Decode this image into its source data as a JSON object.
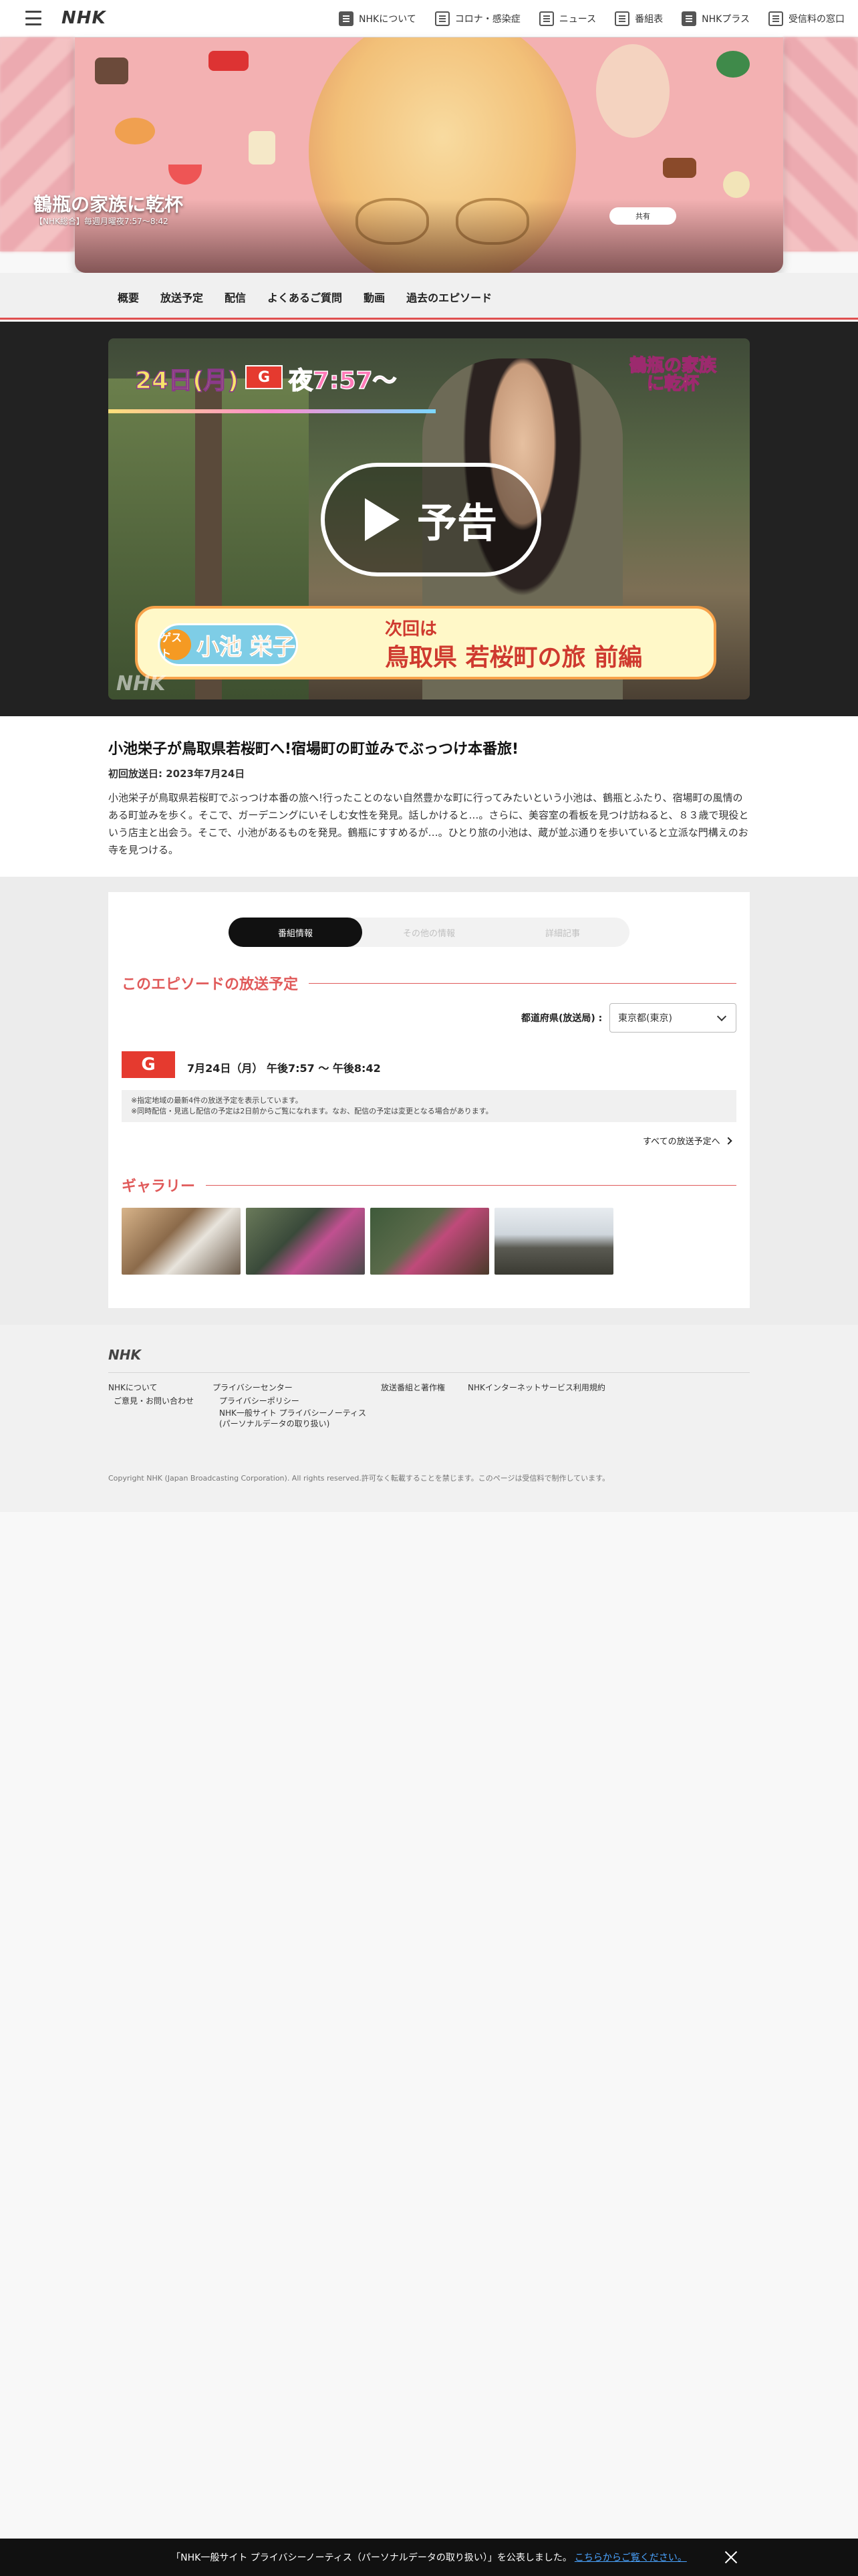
{
  "header": {
    "logo": "NHK",
    "nav": [
      {
        "label": "NHKについて",
        "icon": "nhk-icon"
      },
      {
        "label": "コロナ・感染症",
        "icon": "virus-icon"
      },
      {
        "label": "ニュース",
        "icon": "news-icon"
      },
      {
        "label": "番組表",
        "icon": "schedule-icon"
      },
      {
        "label": "NHKプラス",
        "icon": "plus-icon"
      },
      {
        "label": "受信料の窓口",
        "icon": "fee-icon"
      }
    ]
  },
  "hero": {
    "title": "鶴瓶の家族に乾杯",
    "subtitle": "【NHK総合】毎週月曜夜7:57〜8:42",
    "share_label": "共有"
  },
  "subnav": [
    "概要",
    "放送予定",
    "配信",
    "よくあるご質問",
    "動画",
    "過去のエピソード"
  ],
  "video": {
    "date": "24日(月)",
    "channel": "G",
    "time": "夜7:57〜",
    "show_logo": "鶴瓶の家族に乾杯",
    "play_label": "予告",
    "guest_tag": "ゲスト",
    "guest_name": "小池 栄子",
    "next_label": "次回は",
    "place": "鳥取県 若桜町の旅 前編",
    "watermark": "NHK"
  },
  "episode": {
    "title": "小池栄子が鳥取県若桜町へ!宿場町の町並みでぶっつけ本番旅!",
    "first_air": "初回放送日: 2023年7月24日",
    "description": "小池栄子が鳥取県若桜町でぶっつけ本番の旅へ!行ったことのない自然豊かな町に行ってみたいという小池は、鶴瓶とふたり、宿場町の風情のある町並みを歩く。そこで、ガーデニングにいそしむ女性を発見。話しかけると…。さらに、美容室の看板を見つけ訪ねると、８３歳で現役という店主と出会う。そこで、小池があるものを発見。鶴瓶にすすめるが…。ひとり旅の小池は、蔵が並ぶ通りを歩いていると立派な門構えのお寺を見つける。"
  },
  "panel": {
    "tabs": [
      "番組情報",
      "その他の情報",
      "詳細記事"
    ],
    "schedule_heading": "このエピソードの放送予定",
    "region_label": "都道府県(放送局) :",
    "region_value": "東京都(東京)",
    "channel_badge": "G",
    "schedule_time": "7月24日（月） 午後7:57 〜 午後8:42",
    "note_1": "※指定地域の最新4件の放送予定を表示しています。",
    "note_2": "※同時配信・見逃し配信の予定は2日前からご覧になれます。なお、配信の予定は変更となる場合があります。",
    "all_link": "すべての放送予定へ",
    "gallery_heading": "ギャラリー"
  },
  "footer": {
    "logo": "NHK",
    "links": [
      "NHKについて",
      "ご意見・お問い合わせ",
      "プライバシーセンター",
      "プライバシーポリシー",
      "NHK一般サイト プライバシーノーティス",
      "(パーソナルデータの取り扱い)",
      "放送番組と著作権",
      "NHKインターネットサービス利用規約"
    ],
    "copyright": "Copyright NHK (Japan Broadcasting Corporation). All rights reserved.許可なく転載することを禁じます。このページは受信料で制作しています。"
  },
  "cookie": {
    "text": "「NHK一般サイト プライバシーノーティス（パーソナルデータの取り扱い）」を公表しました。",
    "link": "こちらからご覧ください。"
  },
  "colors": {
    "accent": "#e05a5a",
    "channel_red": "#e53a2f"
  }
}
